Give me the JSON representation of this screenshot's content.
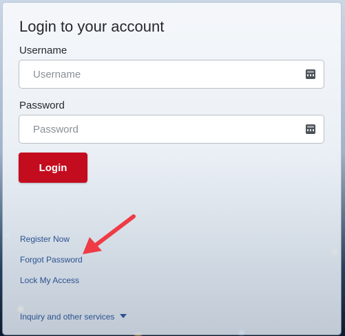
{
  "login": {
    "title": "Login to your account",
    "username_label": "Username",
    "username_placeholder": "Username",
    "password_label": "Password",
    "password_placeholder": "Password",
    "login_button": "Login"
  },
  "links": {
    "register": "Register Now",
    "forgot": "Forgot Password",
    "lock": "Lock My Access"
  },
  "footer": {
    "inquiry": "Inquiry and other services"
  },
  "colors": {
    "accent": "#c40c1f",
    "link": "#2a5190",
    "annotation_arrow": "#ee3b45"
  },
  "icons": {
    "field_icon": "password-manager-key-icon",
    "dropdown_icon": "caret-down-icon",
    "annotation": "red-pointer-arrow-icon"
  }
}
